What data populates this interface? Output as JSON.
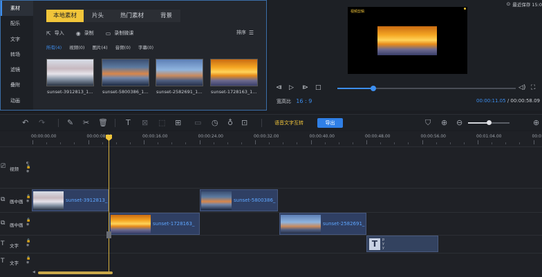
{
  "library": {
    "side_nav": [
      "素材",
      "配乐",
      "文字",
      "转场",
      "滤镜",
      "叠附",
      "动画"
    ],
    "tabs": [
      "本地素材",
      "片头",
      "热门素材",
      "背景"
    ],
    "toolbar": {
      "import": "导入",
      "record": "录制",
      "record_screen": "录制微课",
      "sort": "排序"
    },
    "filters": [
      "所有(4)",
      "视频(0)",
      "图片(4)",
      "音频(0)",
      "字幕(0)"
    ],
    "thumbs": [
      "sunset-3912813_1...",
      "sunset-5800386_1...",
      "sunset-2582691_1...",
      "sunset-1728163_1..."
    ]
  },
  "preview": {
    "autosave": "最近保存 15:0",
    "logo": "视频剪辑",
    "ratio_label": "宽高比",
    "ratio_value": "16 : 9",
    "time_current": "00:00:11.05",
    "time_sep": "/",
    "time_total": "00:00:58.09",
    "seek_progress": 0.2
  },
  "edit_bar": {
    "speech_to_text": "语音文字互转",
    "export": "导出",
    "zoom_level": 0.5
  },
  "timeline": {
    "ticks": [
      "00:00:00.00",
      "00:00:08.00",
      "00:00:16.00",
      "00:00:24.00",
      "00:00:32.00",
      "00:00:40.00",
      "00:00:48.00",
      "00:00:56.00",
      "00:01:04.00",
      "00:01:1"
    ],
    "tracks": [
      {
        "label": "视频"
      },
      {
        "label": "画中画"
      },
      {
        "label": "画中画"
      },
      {
        "label": "文字"
      },
      {
        "label": "文字"
      }
    ],
    "clips": {
      "pip1_a": "sunset-3912813_",
      "pip1_b": "sunset-5800386_",
      "pip2_a": "sunset-1728163_",
      "pip2_b": "sunset-2582691_"
    },
    "text_clip": {
      "glyph": "T",
      "lines": [
        "p",
        "y",
        "y"
      ]
    }
  },
  "colors": {
    "accent": "#3d8ff0",
    "highlight": "#f1c53a",
    "export": "#2f7fe6"
  }
}
